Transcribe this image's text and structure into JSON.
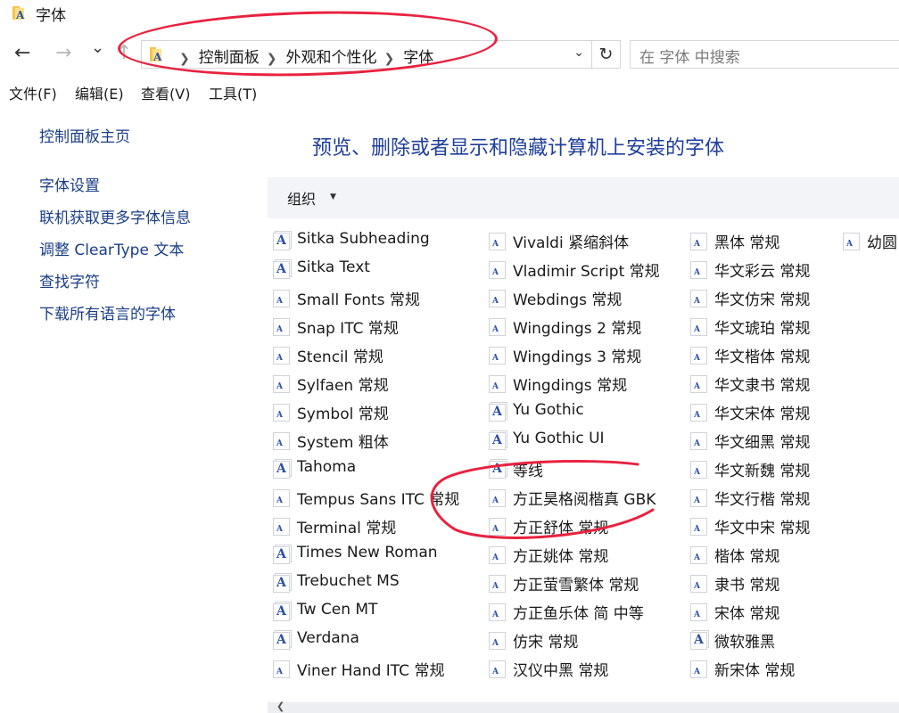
{
  "window": {
    "title": "字体"
  },
  "nav": {
    "back": "←",
    "forward": "→",
    "recent": "⌄",
    "up": "↑",
    "breadcrumbs": [
      "控制面板",
      "外观和个性化",
      "字体"
    ],
    "refresh": "↻",
    "search_placeholder": "在 字体 中搜索"
  },
  "menu": [
    "文件(F)",
    "编辑(E)",
    "查看(V)",
    "工具(T)"
  ],
  "sidebar": {
    "home": "控制面板主页",
    "links": [
      "字体设置",
      "联机获取更多字体信息",
      "调整 ClearType 文本",
      "查找字符",
      "下载所有语言的字体"
    ]
  },
  "main": {
    "heading": "预览、删除或者显示和隐藏计算机上安装的字体",
    "organize": "组织",
    "columns": [
      [
        {
          "name": "Sitka Subheading",
          "icon": "font-family-icon"
        },
        {
          "name": "Sitka Text",
          "icon": "font-family-icon"
        },
        {
          "name": "Small Fonts 常规",
          "icon": "font-file-icon"
        },
        {
          "name": "Snap ITC 常规",
          "icon": "font-file-icon"
        },
        {
          "name": "Stencil 常规",
          "icon": "font-file-icon"
        },
        {
          "name": "Sylfaen 常规",
          "icon": "font-file-icon"
        },
        {
          "name": "Symbol 常规",
          "icon": "font-file-icon"
        },
        {
          "name": "System 粗体",
          "icon": "font-file-icon"
        },
        {
          "name": "Tahoma",
          "icon": "font-family-icon"
        },
        {
          "name": "Tempus Sans ITC 常规",
          "icon": "font-file-icon"
        },
        {
          "name": "Terminal 常规",
          "icon": "font-file-icon"
        },
        {
          "name": "Times New Roman",
          "icon": "font-family-icon"
        },
        {
          "name": "Trebuchet MS",
          "icon": "font-family-icon"
        },
        {
          "name": "Tw Cen MT",
          "icon": "font-family-icon"
        },
        {
          "name": "Verdana",
          "icon": "font-family-icon"
        },
        {
          "name": "Viner Hand ITC 常规",
          "icon": "font-file-icon"
        }
      ],
      [
        {
          "name": "Vivaldi 紧缩斜体",
          "icon": "font-file-icon"
        },
        {
          "name": "Vladimir Script 常规",
          "icon": "font-file-icon"
        },
        {
          "name": "Webdings 常规",
          "icon": "font-file-icon"
        },
        {
          "name": "Wingdings 2 常规",
          "icon": "font-file-icon"
        },
        {
          "name": "Wingdings 3 常规",
          "icon": "font-file-icon"
        },
        {
          "name": "Wingdings 常规",
          "icon": "font-file-icon"
        },
        {
          "name": "Yu Gothic",
          "icon": "font-family-icon"
        },
        {
          "name": "Yu Gothic UI",
          "icon": "font-family-icon"
        },
        {
          "name": "等线",
          "icon": "font-family-icon"
        },
        {
          "name": "方正昊格阅楷真 GBK",
          "icon": "font-file-icon"
        },
        {
          "name": "方正舒体 常规",
          "icon": "font-file-icon"
        },
        {
          "name": "方正姚体 常规",
          "icon": "font-file-icon"
        },
        {
          "name": "方正萤雪繁体 常规",
          "icon": "font-file-icon"
        },
        {
          "name": "方正鱼乐体 简 中等",
          "icon": "font-file-icon"
        },
        {
          "name": "仿宋 常规",
          "icon": "font-file-icon"
        },
        {
          "name": "汉仪中黑 常规",
          "icon": "font-file-icon"
        }
      ],
      [
        {
          "name": "黑体 常规",
          "icon": "font-file-icon"
        },
        {
          "name": "华文彩云 常规",
          "icon": "font-file-icon"
        },
        {
          "name": "华文仿宋 常规",
          "icon": "font-file-icon"
        },
        {
          "name": "华文琥珀 常规",
          "icon": "font-file-icon"
        },
        {
          "name": "华文楷体 常规",
          "icon": "font-file-icon"
        },
        {
          "name": "华文隶书 常规",
          "icon": "font-file-icon"
        },
        {
          "name": "华文宋体 常规",
          "icon": "font-file-icon"
        },
        {
          "name": "华文细黑 常规",
          "icon": "font-file-icon"
        },
        {
          "name": "华文新魏 常规",
          "icon": "font-file-icon"
        },
        {
          "name": "华文行楷 常规",
          "icon": "font-file-icon"
        },
        {
          "name": "华文中宋 常规",
          "icon": "font-file-icon"
        },
        {
          "name": "楷体 常规",
          "icon": "font-file-icon"
        },
        {
          "name": "隶书 常规",
          "icon": "font-file-icon"
        },
        {
          "name": "宋体 常规",
          "icon": "font-file-icon"
        },
        {
          "name": "微软雅黑",
          "icon": "font-family-icon"
        },
        {
          "name": "新宋体 常规",
          "icon": "font-file-icon"
        }
      ],
      [
        {
          "name": "幼圆",
          "icon": "font-file-icon"
        }
      ]
    ]
  },
  "colors": {
    "accent_heading": "#1e3e9a",
    "link": "#1a3e85",
    "annotation": "#e8223f",
    "toolbar_bg": "#f2f4f8"
  }
}
